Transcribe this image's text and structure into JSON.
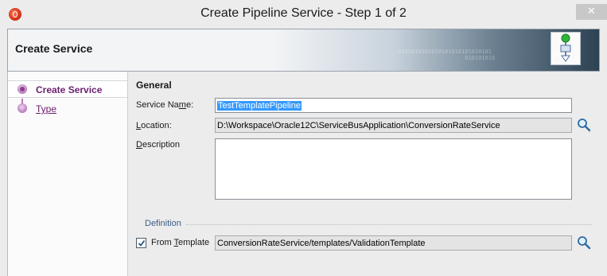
{
  "window": {
    "title": "Create Pipeline Service - Step 1 of 2",
    "close_glyph": "✕"
  },
  "header": {
    "title": "Create Service",
    "binary_text": "0101010101010101010101010101\n                    010101010"
  },
  "nav": {
    "items": [
      {
        "label": "Create Service",
        "selected": true
      },
      {
        "label": "Type",
        "selected": false
      }
    ]
  },
  "form": {
    "section_title": "General",
    "service_name": {
      "label_pre": "Service Na",
      "label_mnemonic": "m",
      "label_post": "e:",
      "value": "TestTemplatePipeline"
    },
    "location": {
      "label_mnemonic": "L",
      "label_post": "ocation:",
      "value": "D:\\Workspace\\Oracle12C\\ServiceBusApplication\\ConversionRateService"
    },
    "description": {
      "label_mnemonic": "D",
      "label_post": "escription",
      "value": ""
    },
    "definition": {
      "title": "Definition",
      "from_template": {
        "label_pre": "From ",
        "label_mnemonic": "T",
        "label_post": "emplate",
        "checked": true,
        "value": "ConversionRateService/templates/ValidationTemplate"
      }
    }
  },
  "icons": {
    "app": "oracle-jdeveloper-icon",
    "wizard": "pipeline-wizard-icon",
    "browse": "magnifier-icon"
  }
}
